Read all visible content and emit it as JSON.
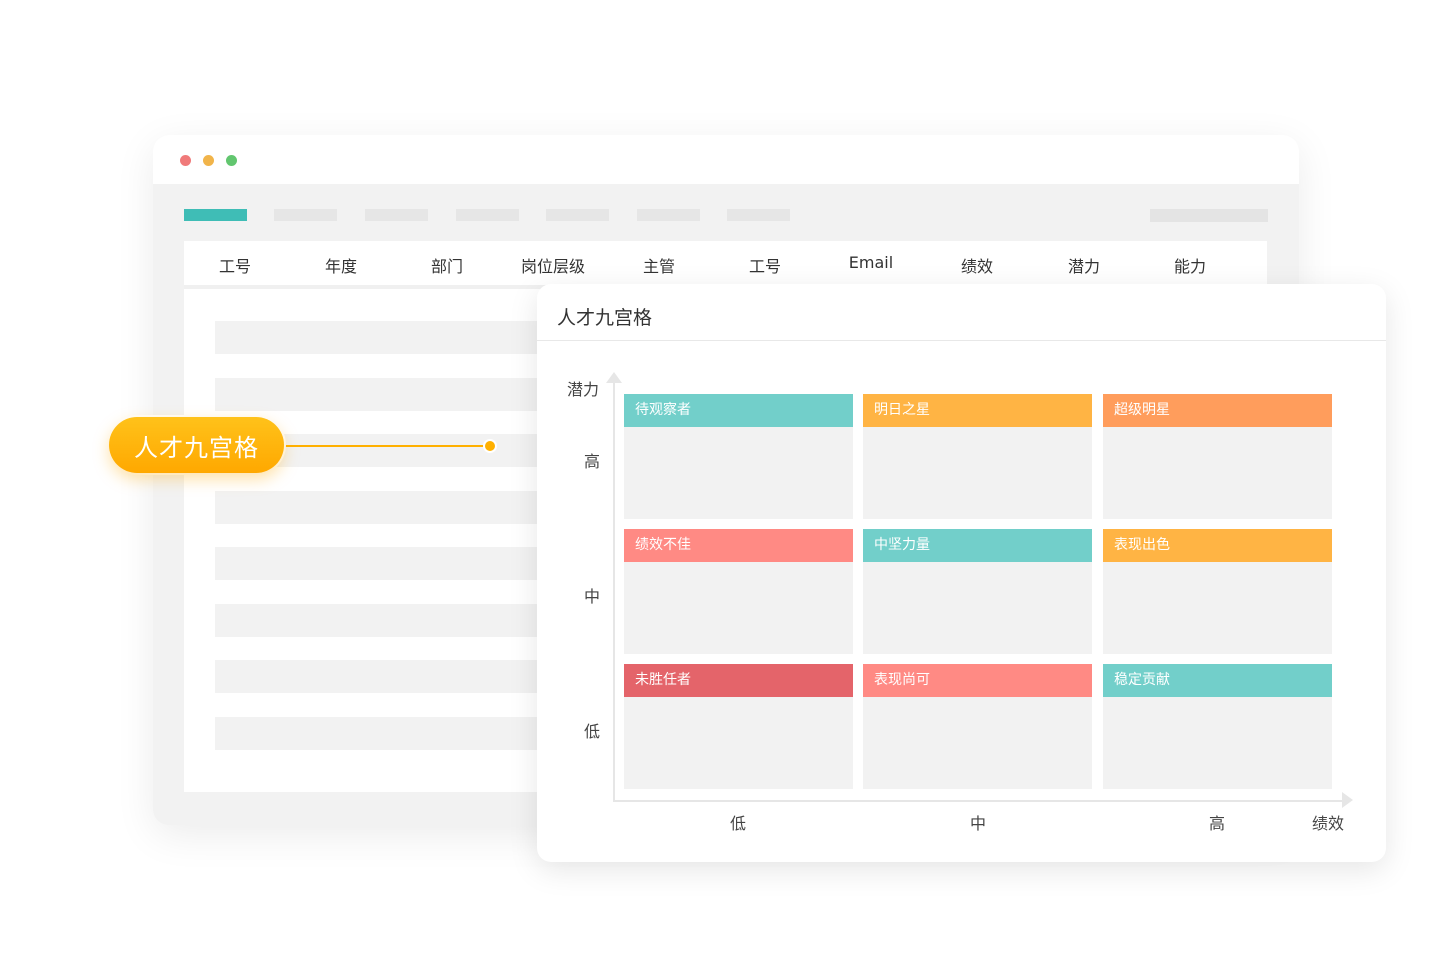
{
  "window": {
    "controls": [
      "close",
      "minimize",
      "maximize"
    ]
  },
  "table": {
    "headers": [
      "工号",
      "年度",
      "部门",
      "岗位层级",
      "主管",
      "工号",
      "Email",
      "绩效",
      "潜力",
      "能力"
    ]
  },
  "callout": {
    "label": "人才九宫格"
  },
  "panel": {
    "title": "人才九宫格",
    "y_axis": {
      "title": "潜力",
      "levels": [
        "高",
        "中",
        "低"
      ]
    },
    "x_axis": {
      "title": "绩效",
      "levels": [
        "低",
        "中",
        "高"
      ]
    },
    "grid": [
      {
        "label": "待观察者",
        "potential": "高",
        "performance": "低",
        "color": "#72cfca"
      },
      {
        "label": "明日之星",
        "potential": "高",
        "performance": "中",
        "color": "#ffb444"
      },
      {
        "label": "超级明星",
        "potential": "高",
        "performance": "高",
        "color": "#ff9d5c"
      },
      {
        "label": "绩效不佳",
        "potential": "中",
        "performance": "低",
        "color": "#ff8a84"
      },
      {
        "label": "中坚力量",
        "potential": "中",
        "performance": "中",
        "color": "#72cfca"
      },
      {
        "label": "表现出色",
        "potential": "中",
        "performance": "高",
        "color": "#ffb444"
      },
      {
        "label": "未胜任者",
        "potential": "低",
        "performance": "低",
        "color": "#e4646a"
      },
      {
        "label": "表现尚可",
        "potential": "低",
        "performance": "中",
        "color": "#ff8a84"
      },
      {
        "label": "稳定贡献",
        "potential": "低",
        "performance": "高",
        "color": "#72cfca"
      }
    ]
  },
  "colors": {
    "accent_tab": "#3fbdb6",
    "callout": "#ffb000"
  }
}
